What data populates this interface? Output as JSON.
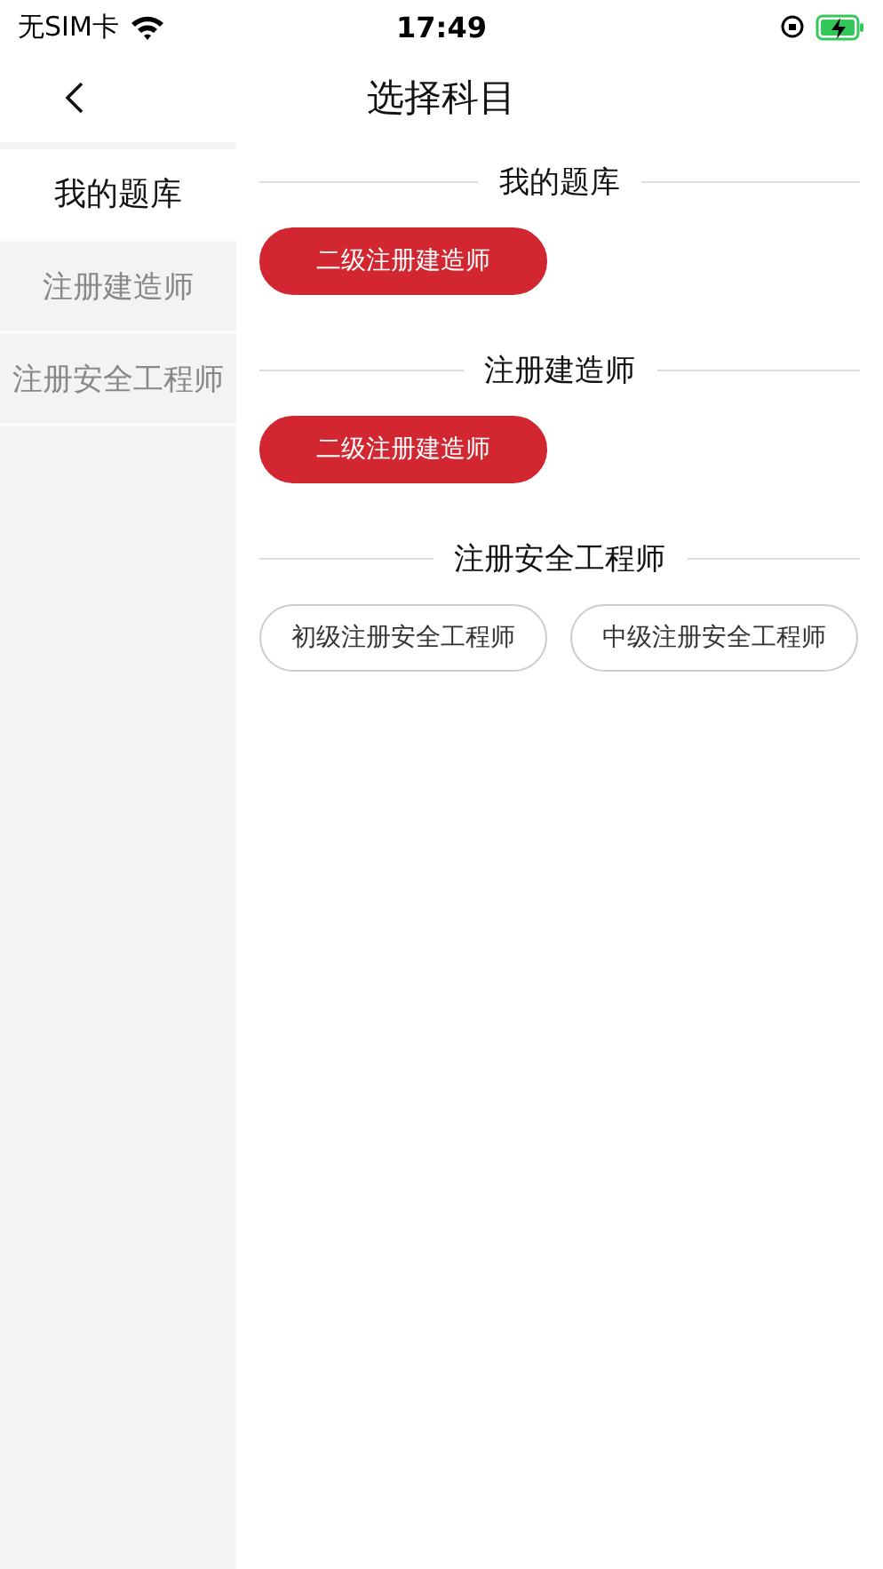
{
  "status_bar": {
    "carrier": "无SIM卡",
    "time": "17:49"
  },
  "nav": {
    "title": "选择科目"
  },
  "sidebar": {
    "items": [
      {
        "label": "我的题库",
        "selected": true
      },
      {
        "label": "注册建造师",
        "selected": false
      },
      {
        "label": "注册安全工程师",
        "selected": false
      }
    ]
  },
  "sections": [
    {
      "title": "我的题库",
      "options": [
        {
          "label": "二级注册建造师",
          "selected": true
        }
      ]
    },
    {
      "title": "注册建造师",
      "options": [
        {
          "label": "二级注册建造师",
          "selected": true
        }
      ]
    },
    {
      "title": "注册安全工程师",
      "options": [
        {
          "label": "初级注册安全工程师",
          "selected": false
        },
        {
          "label": "中级注册安全工程师",
          "selected": false
        }
      ]
    }
  ]
}
